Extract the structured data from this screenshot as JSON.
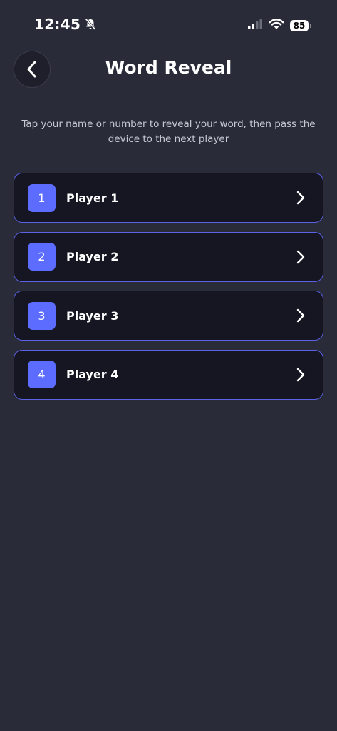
{
  "status_bar": {
    "time": "12:45",
    "battery": "85"
  },
  "header": {
    "title": "Word Reveal"
  },
  "instructions": "Tap your name or number to reveal your word, then pass the device to the next player",
  "players": [
    {
      "number": "1",
      "name": "Player 1"
    },
    {
      "number": "2",
      "name": "Player 2"
    },
    {
      "number": "3",
      "name": "Player 3"
    },
    {
      "number": "4",
      "name": "Player 4"
    }
  ],
  "colors": {
    "background": "#292b38",
    "card": "#161522",
    "accent": "#5b6cff",
    "border": "#5a62e8"
  },
  "icons": {
    "back": "chevron-left-icon",
    "row": "chevron-right-icon",
    "mute": "bell-slash-icon",
    "signal": "signal-icon",
    "wifi": "wifi-icon",
    "battery": "battery-icon"
  }
}
